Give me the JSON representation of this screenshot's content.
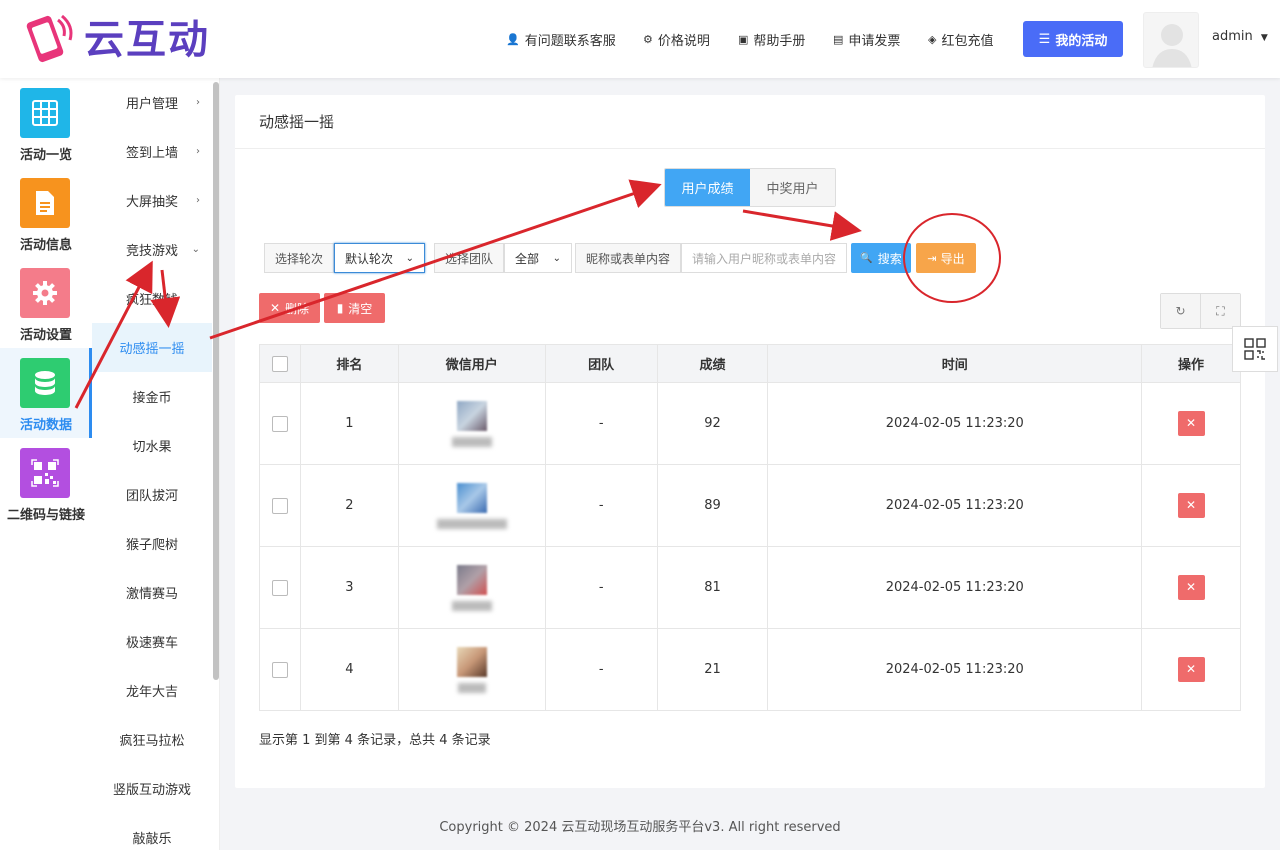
{
  "app": {
    "logo_text": "云互动"
  },
  "header": {
    "nav": [
      {
        "label": "有问题联系客服",
        "icon": "user-plus-icon"
      },
      {
        "label": "价格说明",
        "icon": "gear-icon"
      },
      {
        "label": "帮助手册",
        "icon": "book-icon"
      },
      {
        "label": "申请发票",
        "icon": "printer-icon"
      },
      {
        "label": "红包充值",
        "icon": "shield-check-icon"
      }
    ],
    "my_activity": "我的活动",
    "user": "admin"
  },
  "side1": [
    {
      "label": "活动一览",
      "color": "#1fb6e8",
      "icon": "grid-icon"
    },
    {
      "label": "活动信息",
      "color": "#f7931e",
      "icon": "document-icon"
    },
    {
      "label": "活动设置",
      "color": "#f47c8a",
      "icon": "gear-icon"
    },
    {
      "label": "活动数据",
      "color": "#2ecc71",
      "icon": "database-icon",
      "active": true
    },
    {
      "label": "二维码与链接",
      "color": "#b34fe0",
      "icon": "qrcode-icon"
    }
  ],
  "side2": [
    {
      "label": "用户管理",
      "chev": "›"
    },
    {
      "label": "签到上墙",
      "chev": "›"
    },
    {
      "label": "大屏抽奖",
      "chev": "›"
    },
    {
      "label": "竞技游戏",
      "chev": "⌄"
    },
    {
      "label": "疯狂数钱"
    },
    {
      "label": "动感摇一摇",
      "active": true
    },
    {
      "label": "接金币"
    },
    {
      "label": "切水果"
    },
    {
      "label": "团队拔河"
    },
    {
      "label": "猴子爬树"
    },
    {
      "label": "激情赛马"
    },
    {
      "label": "极速赛车"
    },
    {
      "label": "龙年大吉"
    },
    {
      "label": "疯狂马拉松"
    },
    {
      "label": "竖版互动游戏"
    },
    {
      "label": "敲敲乐"
    }
  ],
  "main": {
    "title": "动感摇一摇",
    "tabs": [
      "用户成绩",
      "中奖用户"
    ],
    "filters": {
      "round_label": "选择轮次",
      "round_value": "默认轮次",
      "team_label": "选择团队",
      "team_value": "全部",
      "keyword_label": "昵称或表单内容",
      "keyword_placeholder": "请输入用户昵称或表单内容"
    },
    "search_label": "搜索",
    "export_label": "导出",
    "delete_label": "删除",
    "clear_label": "清空",
    "table": {
      "headers": [
        "排名",
        "微信用户",
        "团队",
        "成绩",
        "时间",
        "操作"
      ],
      "rows": [
        {
          "rank": "1",
          "team": "-",
          "score": "92",
          "time": "2024-02-05 11:23:20"
        },
        {
          "rank": "2",
          "team": "-",
          "score": "89",
          "time": "2024-02-05 11:23:20"
        },
        {
          "rank": "3",
          "team": "-",
          "score": "81",
          "time": "2024-02-05 11:23:20"
        },
        {
          "rank": "4",
          "team": "-",
          "score": "21",
          "time": "2024-02-05 11:23:20"
        }
      ]
    },
    "summary": "显示第 1 到第 4 条记录，总共 4 条记录"
  },
  "footer": {
    "copyright": "Copyright © 2024 云互动现场互动服务平台v3. All right reserved"
  },
  "colors": {
    "annotation": "#d9262c",
    "primary": "#41a6f4",
    "danger": "#ef6b6b",
    "warning": "#f7a54a"
  }
}
